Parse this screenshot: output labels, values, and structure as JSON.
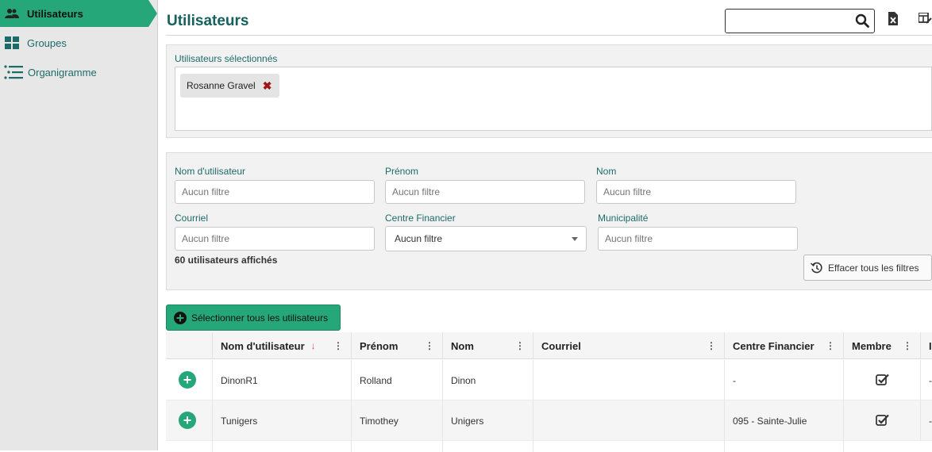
{
  "sidebar": {
    "items": [
      {
        "label": "Utilisateurs",
        "icon": "users-icon"
      },
      {
        "label": "Groupes",
        "icon": "grid-icon"
      },
      {
        "label": "Organigramme",
        "icon": "org-list-icon"
      }
    ]
  },
  "header": {
    "title": "Utilisateurs",
    "search_placeholder": ""
  },
  "selected": {
    "label": "Utilisateurs sélectionnés",
    "chips": [
      "Rosanne Gravel"
    ]
  },
  "filters": {
    "username_label": "Nom d'utilisateur",
    "firstname_label": "Prénom",
    "lastname_label": "Nom",
    "email_label": "Courriel",
    "finance_label": "Centre Financier",
    "municipality_label": "Municipalité",
    "placeholder": "Aucun filtre",
    "finance_value": "Aucun filtre",
    "count_text": "60 utilisateurs affichés",
    "clear_label": "Effacer tous les filtres"
  },
  "select_all_label": "Sélectionner tous les utilisateurs",
  "table": {
    "columns": [
      "Nom d'utilisateur",
      "Prénom",
      "Nom",
      "Courriel",
      "Centre Financier",
      "Membre",
      "I"
    ],
    "sort_indicator": "↓",
    "rows": [
      {
        "username": "DinonR1",
        "firstname": "Rolland",
        "lastname": "Dinon",
        "email": "",
        "finance": "-",
        "member": true,
        "extra": "-"
      },
      {
        "username": "Tunigers",
        "firstname": "Timothey",
        "lastname": "Unigers",
        "email": "",
        "finance": "095 - Sainte-Julie",
        "member": true,
        "extra": "-"
      }
    ]
  },
  "colors": {
    "accent": "#26a77a",
    "title": "#16605e",
    "label": "#1d6b69",
    "remove": "#a31616"
  }
}
